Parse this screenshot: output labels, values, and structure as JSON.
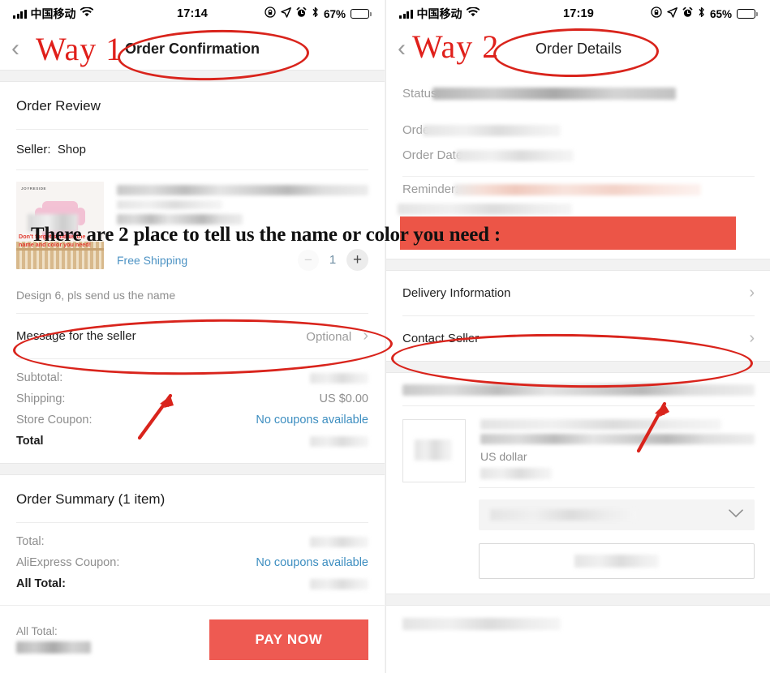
{
  "annotation": {
    "headline": "There are 2 place to tell us the name or color you need :",
    "way1_label": "Way 1",
    "way2_label": "Way 2",
    "accent_red": "#d9241c",
    "band_red": "#ec5547"
  },
  "left_phone": {
    "status": {
      "carrier": "中国移动",
      "time": "17:14",
      "battery_pct": "67%",
      "icons": [
        "signal-icon",
        "wifi-icon",
        "rotation-lock-icon",
        "location-arrow-icon",
        "alarm-clock-icon",
        "bluetooth-icon",
        "battery-icon"
      ]
    },
    "nav": {
      "title": "Order Confirmation",
      "back": "‹"
    },
    "order_review": {
      "title": "Order Review",
      "seller_label": "Seller:",
      "seller_name": "Shop"
    },
    "product": {
      "brand": "JOYRESIDE",
      "image_note": "Don't forget send us the name and color you need!",
      "shipping": "Free Shipping",
      "qty_minus": "−",
      "qty_value": "1",
      "qty_plus": "+",
      "description": "Design 6, pls send us the name"
    },
    "message_row": {
      "label": "Message for the seller",
      "value": "Optional",
      "chevron": "›"
    },
    "price_lines": [
      {
        "label": "Subtotal:",
        "value": "",
        "blurred": true
      },
      {
        "label": "Shipping:",
        "value": "US $0.00",
        "blurred": false
      },
      {
        "label": "Store Coupon:",
        "value": "No coupons available",
        "link": true
      },
      {
        "label": "Total",
        "value": "",
        "blurred": true,
        "bold": true
      }
    ],
    "order_summary": {
      "title": "Order Summary (1 item)",
      "lines": [
        {
          "label": "Total:",
          "value": "",
          "blurred": true
        },
        {
          "label": "AliExpress Coupon:",
          "value": "No coupons available",
          "link": true
        },
        {
          "label": "All Total:",
          "value": "",
          "blurred": true,
          "bold": true
        }
      ]
    },
    "paybar": {
      "total_label": "All Total:",
      "button": "PAY NOW"
    }
  },
  "right_phone": {
    "status": {
      "carrier": "中国移动",
      "time": "17:19",
      "battery_pct": "65%",
      "icons": [
        "signal-icon",
        "wifi-icon",
        "rotation-lock-icon",
        "location-arrow-icon",
        "alarm-clock-icon",
        "bluetooth-icon",
        "battery-icon"
      ]
    },
    "nav": {
      "title": "Order Details",
      "back": "‹"
    },
    "detail_rows": [
      {
        "label": "Status:",
        "value": "",
        "blurred": true
      },
      {
        "label": "Orde",
        "value": "",
        "blurred": true
      },
      {
        "label": "Order Date",
        "value": "",
        "blurred": true
      },
      {
        "label": "Reminder:",
        "value": "",
        "blurred": true,
        "pink": true
      }
    ],
    "links": [
      {
        "label": "Delivery Information",
        "chevron": "›"
      },
      {
        "label": "Contact Seller",
        "chevron": "›"
      }
    ],
    "item_card": {
      "currency": "US dollar"
    }
  }
}
